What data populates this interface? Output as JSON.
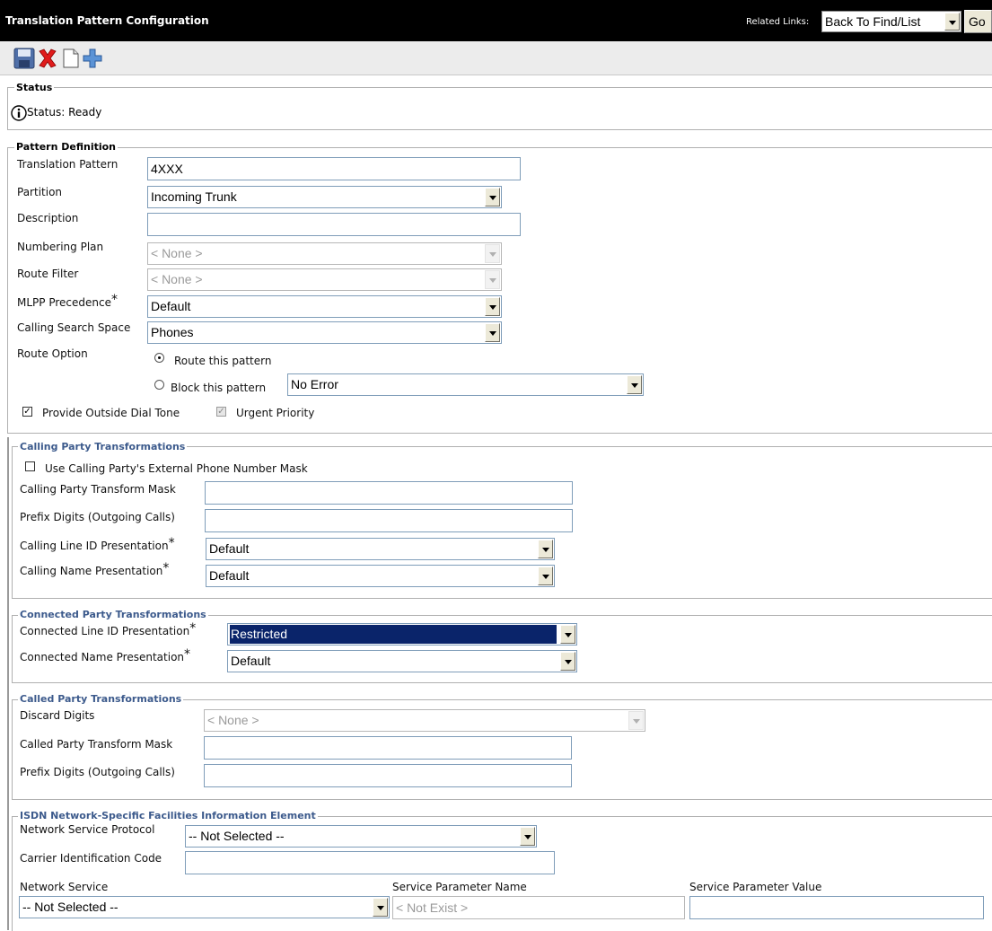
{
  "header": {
    "title": "Translation Pattern Configuration",
    "related_links_label": "Related Links:",
    "related_links_value": "Back To Find/List",
    "go_label": "Go"
  },
  "toolbar": {
    "icons": [
      "save-icon",
      "delete-icon",
      "copy-icon",
      "add-new-icon"
    ]
  },
  "status": {
    "legend": "Status",
    "text": "Status: Ready"
  },
  "pattern_definition": {
    "legend": "Pattern Definition",
    "translation_pattern": {
      "label": "Translation Pattern",
      "value": "4XXX"
    },
    "partition": {
      "label": "Partition",
      "value": "Incoming Trunk"
    },
    "description": {
      "label": "Description",
      "value": ""
    },
    "numbering_plan": {
      "label": "Numbering Plan",
      "value": "< None >"
    },
    "route_filter": {
      "label": "Route Filter",
      "value": "< None >"
    },
    "mlpp_precedence": {
      "label": "MLPP Precedence",
      "value": "Default"
    },
    "calling_search_space": {
      "label": "Calling Search Space",
      "value": "Phones"
    },
    "route_option": {
      "label": "Route Option",
      "route_label": "Route this pattern",
      "block_label": "Block this pattern",
      "block_reason": "No Error"
    },
    "provide_outside_dial_tone": "Provide Outside Dial Tone",
    "urgent_priority": "Urgent Priority"
  },
  "calling_party": {
    "legend": "Calling Party Transformations",
    "use_external_mask": "Use Calling Party's External Phone Number Mask",
    "transform_mask": {
      "label": "Calling Party Transform Mask",
      "value": ""
    },
    "prefix_digits": {
      "label": "Prefix Digits (Outgoing Calls)",
      "value": ""
    },
    "line_id_presentation": {
      "label": "Calling Line ID Presentation",
      "value": "Default"
    },
    "name_presentation": {
      "label": "Calling Name Presentation",
      "value": "Default"
    }
  },
  "connected_party": {
    "legend": "Connected Party Transformations",
    "line_id_presentation": {
      "label": "Connected Line ID Presentation",
      "value": "Restricted"
    },
    "name_presentation": {
      "label": "Connected Name Presentation",
      "value": "Default"
    }
  },
  "called_party": {
    "legend": "Called Party Transformations",
    "discard_digits": {
      "label": "Discard Digits",
      "value": "< None >"
    },
    "transform_mask": {
      "label": "Called Party Transform Mask",
      "value": ""
    },
    "prefix_digits": {
      "label": "Prefix Digits (Outgoing Calls)",
      "value": ""
    }
  },
  "isdn": {
    "legend": "ISDN Network-Specific Facilities Information Element",
    "network_service_protocol": {
      "label": "Network Service Protocol",
      "value": "-- Not Selected --"
    },
    "carrier_identification_code": {
      "label": "Carrier Identification Code",
      "value": ""
    },
    "network_service": {
      "label": "Network Service",
      "value": "-- Not Selected --"
    },
    "service_parameter_name": {
      "label": "Service Parameter Name",
      "value": "< Not Exist >"
    },
    "service_parameter_value": {
      "label": "Service Parameter Value",
      "value": ""
    }
  }
}
